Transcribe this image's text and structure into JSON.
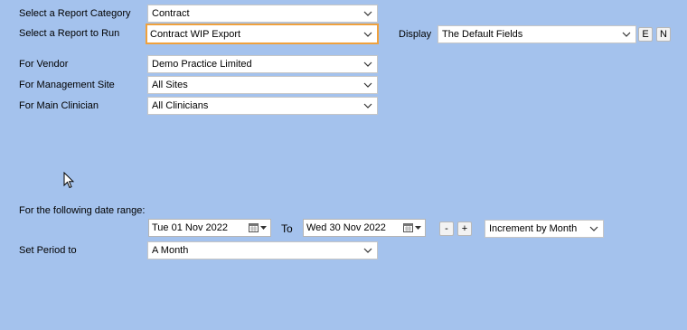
{
  "report_category": {
    "label": "Select a Report Category",
    "value": "Contract"
  },
  "report_to_run": {
    "label": "Select a Report to Run",
    "value": "Contract WIP Export"
  },
  "display": {
    "label": "Display",
    "value": "The Default Fields",
    "edit_btn": "E",
    "new_btn": "N"
  },
  "vendor": {
    "label": "For Vendor",
    "value": "Demo Practice Limited"
  },
  "management_site": {
    "label": "For Management Site",
    "value": "All Sites"
  },
  "main_clinician": {
    "label": "For Main Clinician",
    "value": "All Clinicians"
  },
  "date_range": {
    "label": "For the following date range:",
    "from": "Tue  01 Nov 2022",
    "to_label": "To",
    "to": "Wed 30 Nov 2022",
    "minus_btn": "-",
    "plus_btn": "+",
    "increment": "Increment by Month"
  },
  "period": {
    "label": "Set Period to",
    "value": "A Month"
  },
  "icons": {
    "dropdown": "chevron-down-icon",
    "calendar": "calendar-icon",
    "cursor": "mouse-pointer-icon"
  }
}
